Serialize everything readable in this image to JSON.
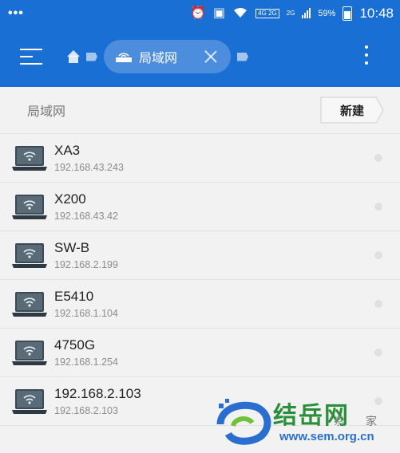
{
  "status": {
    "dots": "•••",
    "network": "4G 2G",
    "network_small": "2G",
    "battery": "59%",
    "time": "10:48"
  },
  "toolbar": {
    "chip_label": "局域网"
  },
  "subhead": {
    "title": "局域网",
    "new_button": "新建"
  },
  "devices": [
    {
      "name": "XA3",
      "ip": "192.168.43.243"
    },
    {
      "name": "X200",
      "ip": "192.168.43.42"
    },
    {
      "name": "SW-B",
      "ip": "192.168.2.199"
    },
    {
      "name": "E5410",
      "ip": "192.168.1.104"
    },
    {
      "name": "4750G",
      "ip": "192.168.1.254"
    },
    {
      "name": "192.168.2.103",
      "ip": "192.168.2.103"
    }
  ],
  "watermark": {
    "brand": "结岳网",
    "url": "www.sem.org.cn",
    "side1": "家",
    "side2": "系"
  },
  "colors": {
    "primary": "#1a6fd4",
    "background": "#f2f2f2"
  }
}
